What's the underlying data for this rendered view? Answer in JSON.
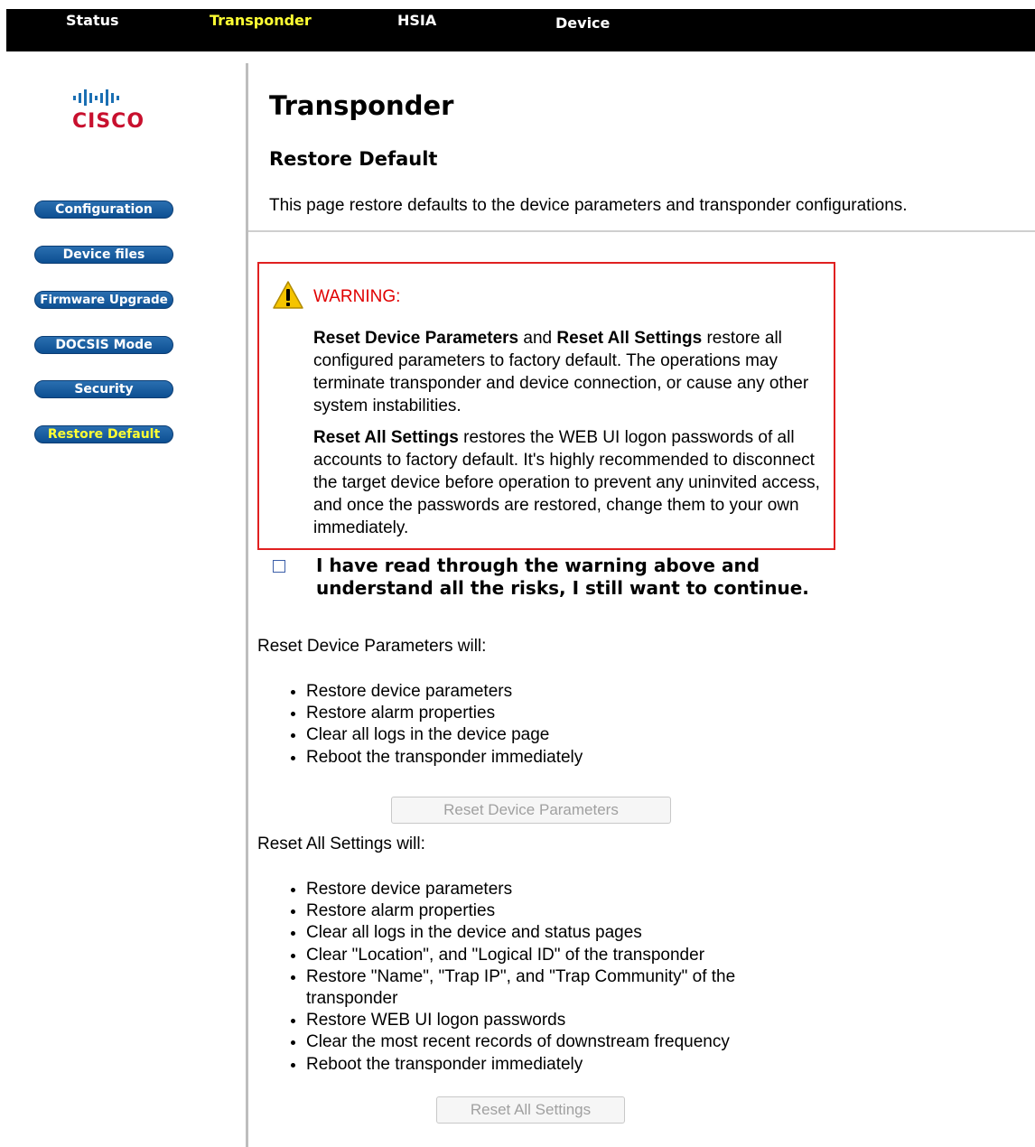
{
  "topnav": {
    "tabs": [
      {
        "label": "Status",
        "active": false
      },
      {
        "label": "Transponder",
        "active": true
      },
      {
        "label": "HSIA",
        "active": false
      },
      {
        "label": "Device",
        "active": false
      }
    ],
    "active_color": "#ffff33"
  },
  "logo": {
    "text": "cisco"
  },
  "sidebar": {
    "items": [
      {
        "label": "Configuration"
      },
      {
        "label": "Device files"
      },
      {
        "label": "Firmware Upgrade"
      },
      {
        "label": "DOCSIS Mode"
      },
      {
        "label": "Security"
      },
      {
        "label": "Restore Default",
        "active": true
      }
    ]
  },
  "page": {
    "title": "Transponder",
    "section_title": "Restore Default",
    "description": "This page restore defaults to the device parameters and transponder configurations."
  },
  "warning": {
    "icon": "warning-triangle-icon",
    "title": "WARNING:",
    "para1_bold1": "Reset Device Parameters",
    "para1_and": " and ",
    "para1_bold2": "Reset All Settings",
    "para1_rest": " restore all configured parameters to factory default. The operations may terminate transponder and device connection, or cause any other system instabilities.",
    "para2_bold": "Reset All Settings",
    "para2_rest": " restores the WEB UI logon passwords of all accounts to factory default. It's highly recommended to disconnect the target device before operation to prevent any uninvited access, and once the passwords are restored, change them to your own immediately.",
    "border_color": "#e02020"
  },
  "confirm": {
    "checked": false,
    "label": "I have read through the warning above and understand all the risks, I still want to continue."
  },
  "reset_device": {
    "heading": "Reset Device Parameters will:",
    "items": [
      "Restore device parameters",
      "Restore alarm properties",
      "Clear all logs in the device page",
      "Reboot the transponder immediately"
    ],
    "button_label": "Reset Device Parameters",
    "button_disabled": true
  },
  "reset_all": {
    "heading": "Reset All Settings will:",
    "items": [
      "Restore device parameters",
      "Restore alarm properties",
      "Clear all logs in the device and status pages",
      "Clear \"Location\", and \"Logical ID\" of the transponder",
      "Restore \"Name\", \"Trap IP\", and \"Trap Community\" of the transponder",
      "Restore WEB UI logon passwords",
      "Clear the most recent records of downstream frequency",
      "Reboot the transponder immediately"
    ],
    "button_label": "Reset All Settings",
    "button_disabled": true
  }
}
